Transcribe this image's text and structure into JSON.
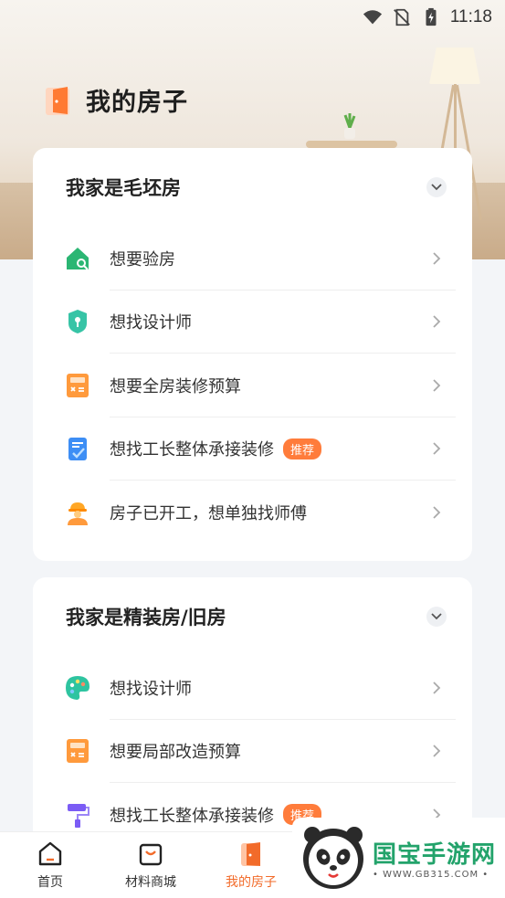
{
  "status_bar": {
    "time": "11:18"
  },
  "header": {
    "title": "我的房子"
  },
  "cards": [
    {
      "title": "我家是毛坯房",
      "items": [
        {
          "label": "想要验房",
          "icon": "house-search-icon",
          "badge": ""
        },
        {
          "label": "想找设计师",
          "icon": "designer-shield-icon",
          "badge": ""
        },
        {
          "label": "想要全房装修预算",
          "icon": "calculator-icon",
          "badge": ""
        },
        {
          "label": "想找工长整体承接装修",
          "icon": "clipboard-check-icon",
          "badge": "推荐"
        },
        {
          "label": "房子已开工，想单独找师傅",
          "icon": "worker-helmet-icon",
          "badge": ""
        }
      ]
    },
    {
      "title": "我家是精装房/旧房",
      "items": [
        {
          "label": "想找设计师",
          "icon": "palette-icon",
          "badge": ""
        },
        {
          "label": "想要局部改造预算",
          "icon": "calculator-icon",
          "badge": ""
        },
        {
          "label": "想找工长整体承接装修",
          "icon": "paint-roller-icon",
          "badge": "推荐"
        }
      ]
    }
  ],
  "tabbar": [
    {
      "label": "首页",
      "icon": "home-icon",
      "active": false
    },
    {
      "label": "材料商城",
      "icon": "shopping-bag-icon",
      "active": false
    },
    {
      "label": "我的房子",
      "icon": "door-icon",
      "active": true
    }
  ],
  "watermark": {
    "brand": "国宝手游网",
    "url": "• WWW.GB315.COM •"
  },
  "colors": {
    "accent": "#f26b2a",
    "badge": "#ff7c3b",
    "green": "#2bb673"
  }
}
